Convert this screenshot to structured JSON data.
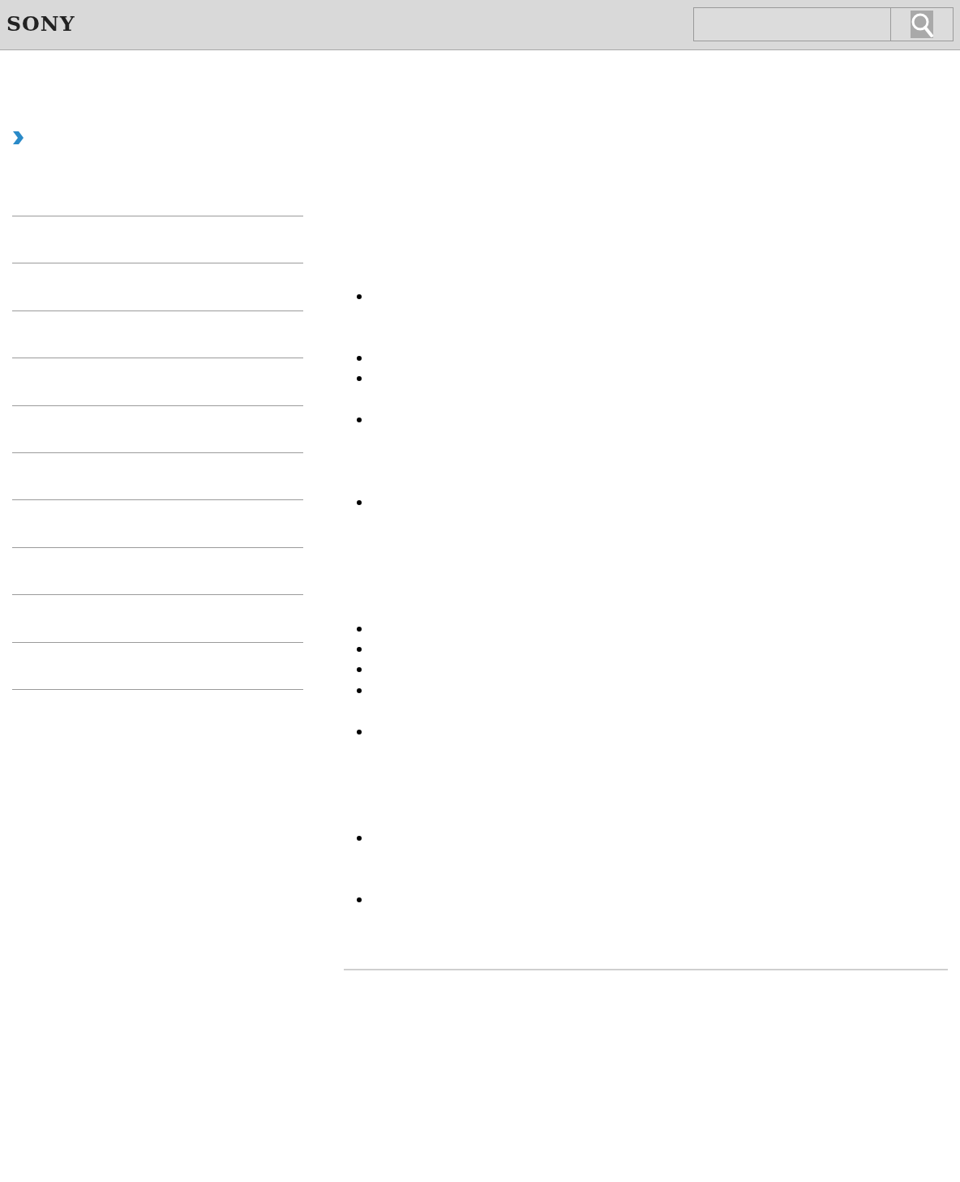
{
  "header": {
    "logo": "SONY"
  }
}
